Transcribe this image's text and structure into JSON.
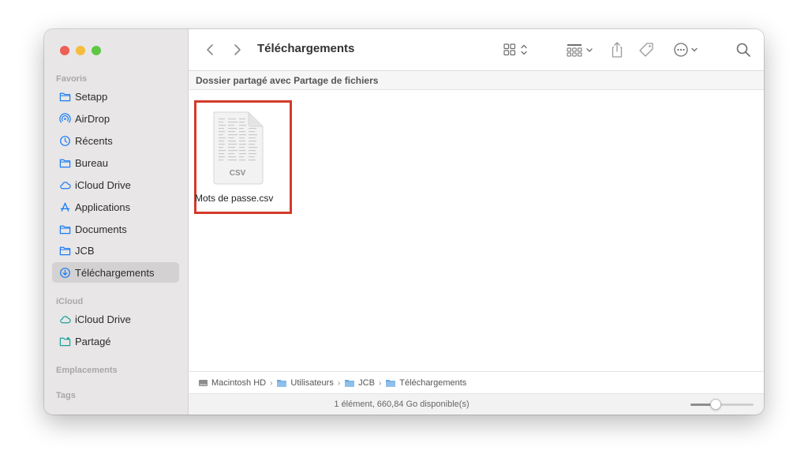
{
  "sidebar": {
    "sections": [
      {
        "title": "Favoris"
      },
      {
        "title": "iCloud"
      },
      {
        "title": "Emplacements"
      },
      {
        "title": "Tags"
      }
    ],
    "favorites": [
      {
        "label": "Setapp",
        "icon": "folder-icon"
      },
      {
        "label": "AirDrop",
        "icon": "airdrop-icon"
      },
      {
        "label": "Récents",
        "icon": "clock-icon"
      },
      {
        "label": "Bureau",
        "icon": "folder-icon"
      },
      {
        "label": "iCloud Drive",
        "icon": "cloud-icon"
      },
      {
        "label": "Applications",
        "icon": "applications-icon"
      },
      {
        "label": "Documents",
        "icon": "folder-icon"
      },
      {
        "label": "JCB",
        "icon": "folder-icon"
      },
      {
        "label": "Téléchargements",
        "icon": "download-icon",
        "selected": true
      }
    ],
    "icloud": [
      {
        "label": "iCloud Drive",
        "icon": "cloud-icon"
      },
      {
        "label": "Partagé",
        "icon": "shared-folder-icon"
      }
    ]
  },
  "toolbar": {
    "title": "Téléchargements"
  },
  "shared_banner": "Dossier partagé avec Partage de fichiers",
  "files": [
    {
      "name": "Mots de passe.csv",
      "type_label": "CSV",
      "highlighted": true
    }
  ],
  "pathbar": [
    {
      "label": "Macintosh HD",
      "icon": "disk-icon"
    },
    {
      "label": "Utilisateurs",
      "icon": "folder-icon"
    },
    {
      "label": "JCB",
      "icon": "folder-icon"
    },
    {
      "label": "Téléchargements",
      "icon": "folder-icon"
    }
  ],
  "status": {
    "text": "1 élément, 660,84 Go disponible(s)",
    "zoom_fraction": 0.4
  },
  "colors": {
    "accent": "#1a7cf5",
    "highlight_border": "#d23b2b",
    "sidebar_bg": "#e8e6e7"
  }
}
